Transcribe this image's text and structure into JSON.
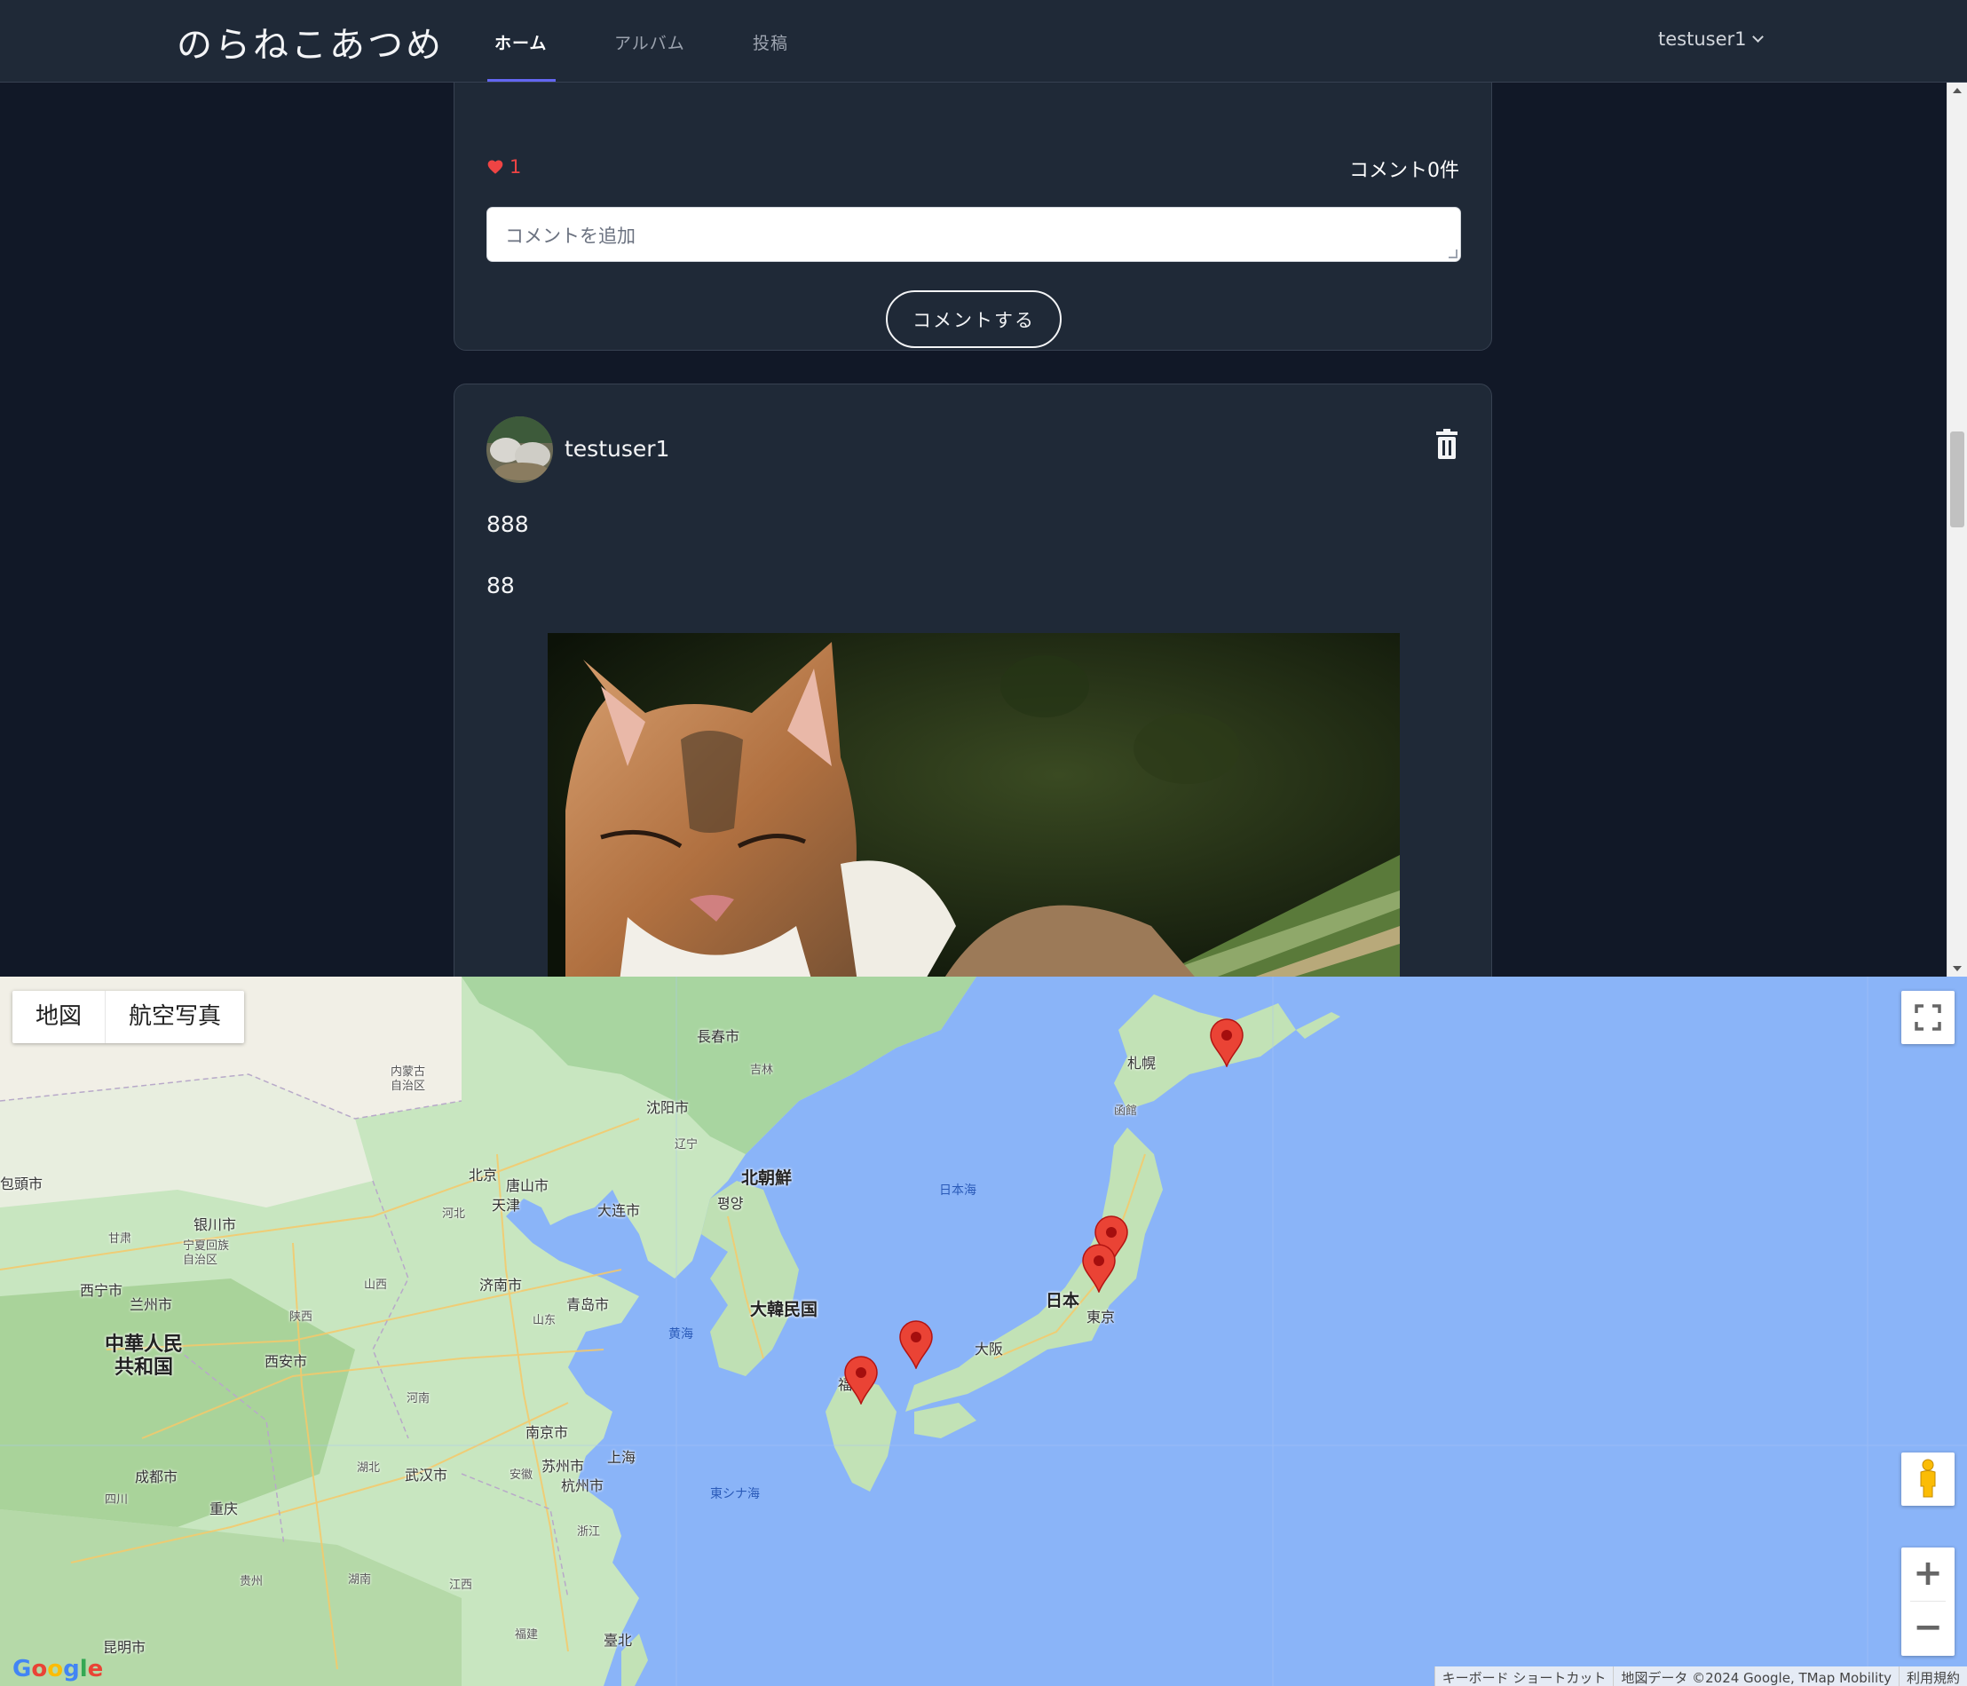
{
  "header": {
    "brand": "のらねこあつめ",
    "nav": [
      {
        "label": "ホーム",
        "active": true
      },
      {
        "label": "アルバム",
        "active": false
      },
      {
        "label": "投稿",
        "active": false
      }
    ],
    "user": "testuser1"
  },
  "post_prev": {
    "likes": "1",
    "comment_count": "コメント0件",
    "comment_placeholder": "コメントを追加",
    "comment_button": "コメントする"
  },
  "post": {
    "user": "testuser1",
    "title": "888",
    "body": "88"
  },
  "map": {
    "map_type_map": "地図",
    "map_type_satellite": "航空写真",
    "labels": {
      "changchun": "長春市",
      "jilin": "吉林",
      "sapporo": "札幌",
      "hakodate": "函館",
      "innermongolia": "内蒙古\n自治区",
      "shenyang": "沈阳市",
      "liaoning": "辽宁",
      "beijing": "北京",
      "tangshan": "唐山市",
      "tianjin": "天津",
      "hebei": "河北",
      "dalian": "大连市",
      "northkorea": "北朝鮮",
      "pyongyang": "평양",
      "seaofjapan": "日本海",
      "yinchuan": "银川市",
      "gansu": "甘肃",
      "ningxia": "宁夏回族\n自治区",
      "xining": "西宁市",
      "lanzhou": "兰州市",
      "shanxi": "山西",
      "shaanxi": "陕西",
      "jinan": "济南市",
      "qingdao": "青岛市",
      "shandong": "山东",
      "southkorea": "大韓民国",
      "yellowsea": "黄海",
      "japan": "日本",
      "tokyo": "東京",
      "osaka": "大阪",
      "china": "中華人民\n共和国",
      "xian": "西安市",
      "henan": "河南",
      "nanjing": "南京市",
      "shanghai": "上海",
      "suzhou": "苏州市",
      "hangzhou": "杭州市",
      "anhui": "安徽",
      "zhejiang": "浙江",
      "eastchinasea": "東シナ海",
      "chengdu": "成都市",
      "sichuan": "四川",
      "chongqing": "重庆",
      "hubei": "湖北",
      "wuhan": "武汉市",
      "hunan": "湖南",
      "jiangxi": "江西",
      "guizhou": "贵州",
      "fujian": "福建",
      "taipei": "臺北",
      "kunming": "昆明市",
      "baotou": "包頭市",
      "fukuoka": "福"
    },
    "attribution": [
      "キーボード ショートカット",
      "地図データ ©2024 Google, TMap Mobility",
      "利用規約"
    ]
  },
  "colors": {
    "page_bg": "#111827",
    "card_bg": "#1f2937",
    "accent": "#6366f1",
    "like": "#ef4444",
    "marker": "#ea4335"
  }
}
